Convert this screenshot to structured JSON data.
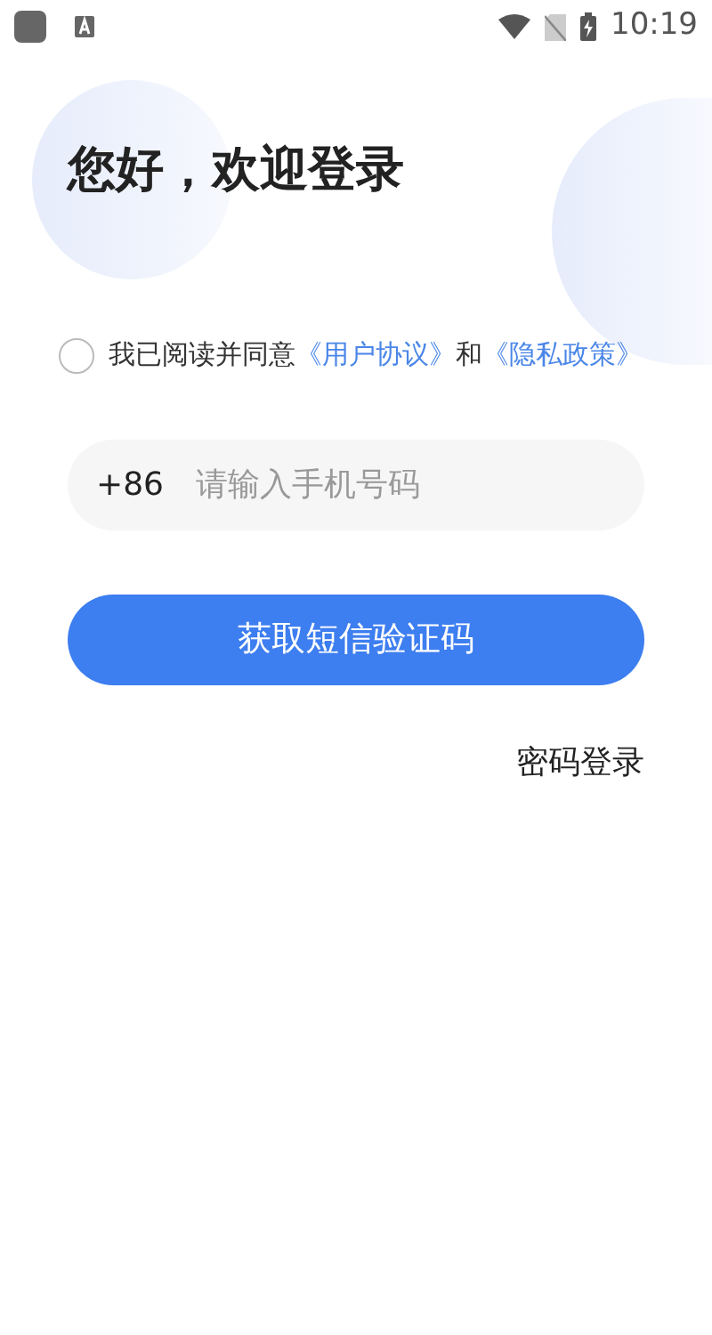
{
  "status_bar": {
    "time": "10:19"
  },
  "title": "您好，欢迎登录",
  "agreement": {
    "checked": false,
    "parts": [
      {
        "kind": "text",
        "text": "我已阅读并同意"
      },
      {
        "kind": "link",
        "text": "《用户协议》"
      },
      {
        "kind": "text",
        "text": "和"
      },
      {
        "kind": "link",
        "text": "《隐私政策》"
      }
    ]
  },
  "phone_field": {
    "prefix": "+86",
    "placeholder": "请输入手机号码"
  },
  "primary_button": "获取短信验证码",
  "password_login": "密码登录"
}
